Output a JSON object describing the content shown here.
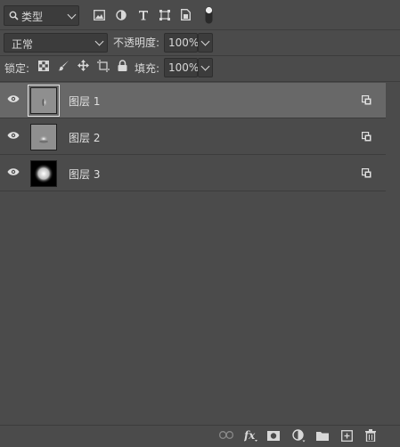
{
  "filter": {
    "kind_label": "类型"
  },
  "blend": {
    "mode": "正常",
    "opacity_label": "不透明度:",
    "opacity_value": "100%"
  },
  "lock": {
    "label": "锁定:",
    "fill_label": "填充:",
    "fill_value": "100%"
  },
  "layers": [
    {
      "name": "图层 1",
      "selected": true,
      "thumb": "gray"
    },
    {
      "name": "图层 2",
      "selected": false,
      "thumb": "gray"
    },
    {
      "name": "图层 3",
      "selected": false,
      "thumb": "black"
    }
  ],
  "colors": {
    "panel": "#4b4b4b",
    "selected_row": "#686868",
    "field_bg": "#3c3c3c"
  }
}
